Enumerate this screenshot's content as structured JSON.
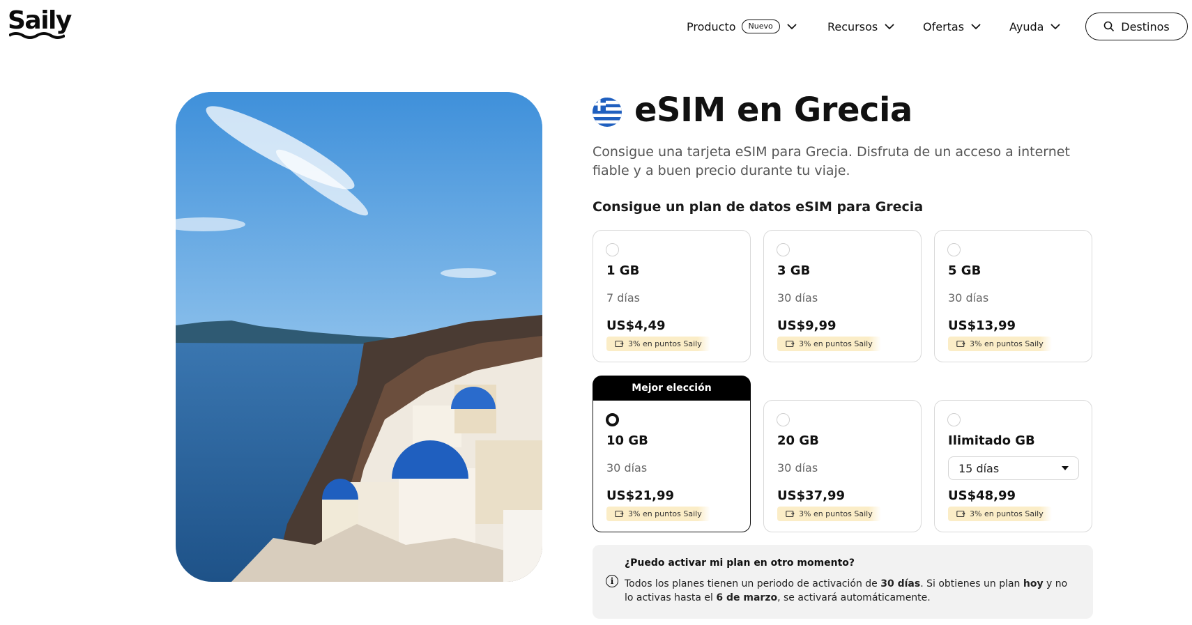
{
  "header": {
    "logo": "Saily",
    "nav": [
      {
        "label": "Producto",
        "badge": "Nuevo"
      },
      {
        "label": "Recursos"
      },
      {
        "label": "Ofertas"
      },
      {
        "label": "Ayuda"
      }
    ],
    "destinations_button": "Destinos",
    "icons": {
      "dropdown": "chevron-down-icon",
      "search": "search-icon"
    }
  },
  "hero": {
    "image": "santorini-blue-domes-photo"
  },
  "main": {
    "title": "eSIM en Grecia",
    "flag": "greece-flag-icon",
    "subtitle": "Consigue una tarjeta eSIM para Grecia. Disfruta de un acceso a internet fiable y a buen precio durante tu viaje.",
    "plans_heading": "Consigue un plan de datos eSIM para Grecia",
    "best_choice_label": "Mejor elección",
    "points_label": "3% en puntos Saily",
    "plans": [
      {
        "gb": "1 GB",
        "days": "7 días",
        "price": "US$4,49",
        "selected": false
      },
      {
        "gb": "3 GB",
        "days": "30 días",
        "price": "US$9,99",
        "selected": false
      },
      {
        "gb": "5 GB",
        "days": "30 días",
        "price": "US$13,99",
        "selected": false
      },
      {
        "gb": "10 GB",
        "days": "30 días",
        "price": "US$21,99",
        "selected": true
      },
      {
        "gb": "20 GB",
        "days": "30 días",
        "price": "US$37,99",
        "selected": false
      },
      {
        "gb": "Ilimitado GB",
        "days_select": "15 días",
        "price": "US$48,99",
        "selected": false
      }
    ],
    "info": {
      "question": "¿Puedo activar mi plan en otro momento?",
      "answer_parts": [
        "Todos los planes tienen un periodo de activación de ",
        "30 días",
        ". Si obtienes un plan ",
        "hoy",
        " y no lo activas hasta el ",
        "6 de marzo",
        ", se activará automáticamente."
      ]
    }
  },
  "colors": {
    "accent": "#000000",
    "points_bg": "#fbedc7",
    "info_bg": "#f2f2f2",
    "greek_blue": "#1f5fbf"
  }
}
